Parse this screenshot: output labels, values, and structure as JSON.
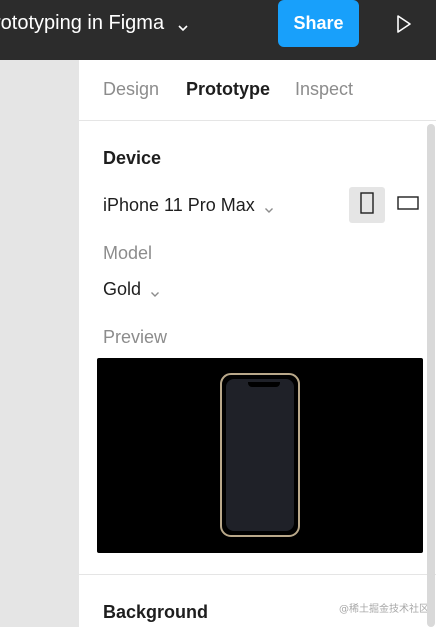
{
  "topbar": {
    "file_title": "rototyping in Figma",
    "share_label": "Share"
  },
  "tabs": [
    {
      "label": "Design",
      "active": false
    },
    {
      "label": "Prototype",
      "active": true
    },
    {
      "label": "Inspect",
      "active": false
    }
  ],
  "device": {
    "section_title": "Device",
    "selected": "iPhone 11 Pro Max",
    "orientation": "portrait"
  },
  "model": {
    "label": "Model",
    "selected": "Gold"
  },
  "preview": {
    "label": "Preview"
  },
  "background": {
    "section_title": "Background"
  },
  "watermark": "@稀土掘金技术社区",
  "colors": {
    "topbar_bg": "#2c2c2c",
    "share_button": "#18a0fb",
    "canvas_bg": "#e5e5e5",
    "preview_bg": "#000000",
    "phone_frame_gold": "#b9a88a"
  },
  "icons": {
    "title_chevron": "chevron-down-icon",
    "play": "play-icon",
    "device_chevron": "chevron-down-icon",
    "model_chevron": "chevron-down-icon",
    "portrait": "portrait-icon",
    "landscape": "landscape-icon"
  }
}
